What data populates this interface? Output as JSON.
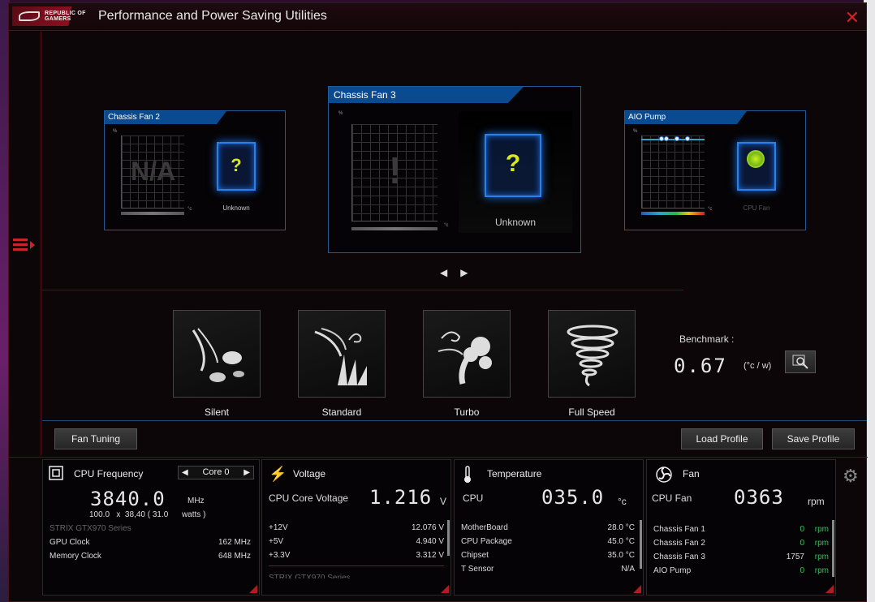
{
  "window": {
    "title": "Performance and Power Saving Utilities",
    "logo_text": "REPUBLIC OF GAMERS",
    "close_icon": "close-icon"
  },
  "fan_cards": {
    "left": {
      "name": "Chassis Fan 2",
      "graph_text": "N/A",
      "status": "Unknown"
    },
    "center": {
      "name": "Chassis Fan 3",
      "graph_text": "!",
      "status": "Unknown"
    },
    "right": {
      "name": "AIO Pump",
      "status": "CPU Fan"
    },
    "y_unit": "%",
    "x_unit": "°c",
    "y_ticks": [
      "100",
      "90",
      "80",
      "70",
      "60",
      "50",
      "40",
      "30",
      "20",
      "10"
    ],
    "x_ticks": [
      "10",
      "20",
      "30",
      "40",
      "50",
      "60",
      "70",
      "80",
      "90",
      "100"
    ]
  },
  "modes": [
    {
      "label": "Silent",
      "icon": "silent-leaves-icon"
    },
    {
      "label": "Standard",
      "icon": "standard-wind-icon"
    },
    {
      "label": "Turbo",
      "icon": "turbo-gust-icon"
    },
    {
      "label": "Full Speed",
      "icon": "tornado-icon"
    }
  ],
  "benchmark": {
    "label": "Benchmark :",
    "value": "0.67",
    "unit": "(°c / w)"
  },
  "buttons": {
    "fan_tuning": "Fan Tuning",
    "load_profile": "Load Profile",
    "save_profile": "Save Profile"
  },
  "cpu_panel": {
    "title": "CPU Frequency",
    "core": "Core 0",
    "frequency": "3840.0",
    "freq_unit": "MHz",
    "ratio_line": "100.0   x  38,40 ( 31.0      watts )",
    "gpu_series": "STRIX GTX970 Series",
    "gpu_clock_label": "GPU Clock",
    "gpu_clock_value": "162 MHz",
    "mem_clock_label": "Memory Clock",
    "mem_clock_value": "648 MHz"
  },
  "voltage_panel": {
    "title": "Voltage",
    "main_label": "CPU Core Voltage",
    "main_value": "1.216",
    "main_unit": "V",
    "rows": [
      {
        "label": "+12V",
        "value": "12.076  V"
      },
      {
        "label": "+5V",
        "value": "4.940  V"
      },
      {
        "label": "+3.3V",
        "value": "3.312  V"
      }
    ],
    "footer": "STRIX GTX970 Series"
  },
  "temp_panel": {
    "title": "Temperature",
    "main_label": "CPU",
    "main_value": "035.0",
    "main_unit": "°c",
    "rows": [
      {
        "label": "MotherBoard",
        "value": "28.0 °C"
      },
      {
        "label": "CPU Package",
        "value": "45.0 °C"
      },
      {
        "label": "Chipset",
        "value": "35.0 °C"
      },
      {
        "label": "T Sensor",
        "value": "N/A"
      }
    ]
  },
  "fan_panel": {
    "title": "Fan",
    "main_label": "CPU Fan",
    "main_value": "0363",
    "main_unit": "rpm",
    "rows": [
      {
        "label": "Chassis Fan 1",
        "value": "0",
        "unit": "rpm"
      },
      {
        "label": "Chassis Fan 2",
        "value": "0",
        "unit": "rpm"
      },
      {
        "label": "Chassis Fan 3",
        "value": "1757",
        "unit": "rpm"
      },
      {
        "label": "AIO Pump",
        "value": "0",
        "unit": "rpm"
      }
    ]
  }
}
